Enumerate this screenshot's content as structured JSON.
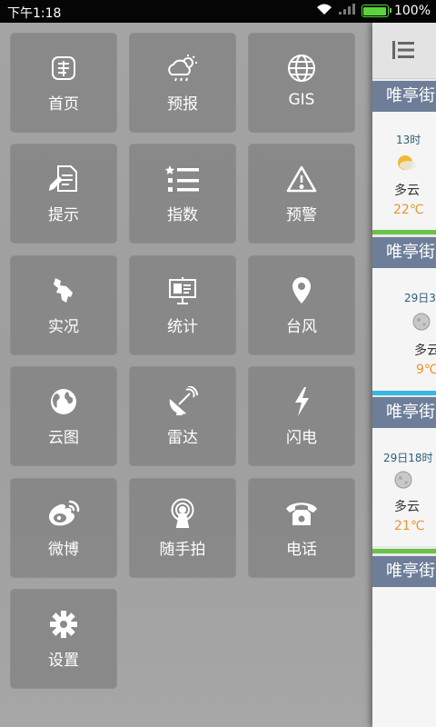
{
  "status_bar": {
    "time": "下午1:18",
    "battery": "100%",
    "battery_level": 1.0
  },
  "menu": {
    "tiles": [
      {
        "label": "首页",
        "icon": "home-icon"
      },
      {
        "label": "预报",
        "icon": "forecast-icon"
      },
      {
        "label": "GIS",
        "icon": "globe-icon"
      },
      {
        "label": "提示",
        "icon": "tips-icon"
      },
      {
        "label": "指数",
        "icon": "list-icon"
      },
      {
        "label": "预警",
        "icon": "warning-icon"
      },
      {
        "label": "实况",
        "icon": "live-icon"
      },
      {
        "label": "统计",
        "icon": "statistics-icon"
      },
      {
        "label": "台风",
        "icon": "location-pin-icon"
      },
      {
        "label": "云图",
        "icon": "earth-icon"
      },
      {
        "label": "雷达",
        "icon": "radar-dish-icon"
      },
      {
        "label": "闪电",
        "icon": "lightning-icon"
      },
      {
        "label": "微博",
        "icon": "weibo-icon"
      },
      {
        "label": "随手拍",
        "icon": "broadcast-icon"
      },
      {
        "label": "电话",
        "icon": "telephone-icon"
      },
      {
        "label": "设置",
        "icon": "gear-icon"
      }
    ]
  },
  "panel": {
    "sections": [
      {
        "header": "唯亭街",
        "time": "13时",
        "weather": "多云",
        "temp": "22℃"
      },
      {
        "header": "唯亭街",
        "time": "29日3",
        "weather": "多云",
        "temp": "9℃"
      },
      {
        "header": "唯亭街",
        "time": "29日18时",
        "weather": "多云",
        "temp": "21℃"
      },
      {
        "header": "唯亭街"
      }
    ]
  },
  "colors": {
    "section_header": "#6e7e99",
    "temp": "#e8962a",
    "divider_green": "#69c24a",
    "divider_blue": "#36b6e4"
  }
}
